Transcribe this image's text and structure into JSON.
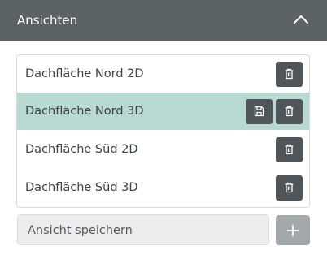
{
  "panel": {
    "title": "Ansichten",
    "collapse_icon": "chevron-up-icon"
  },
  "views": {
    "items": [
      {
        "label": "Dachfläche Nord 2D",
        "selected": false,
        "actions": [
          "trash-icon"
        ]
      },
      {
        "label": "Dachfläche Nord 3D",
        "selected": true,
        "actions": [
          "save-icon",
          "trash-icon"
        ]
      },
      {
        "label": "Dachfläche Süd 2D",
        "selected": false,
        "actions": [
          "trash-icon"
        ]
      },
      {
        "label": "Dachfläche Süd 3D",
        "selected": false,
        "actions": [
          "trash-icon"
        ]
      }
    ]
  },
  "save_view": {
    "placeholder": "Ansicht speichern",
    "add_icon": "plus-icon"
  },
  "colors": {
    "header_bg": "#5c6164",
    "selected_bg": "#b8d9d1",
    "button_bg": "#50555a",
    "add_button_bg": "#a3a8ab"
  }
}
